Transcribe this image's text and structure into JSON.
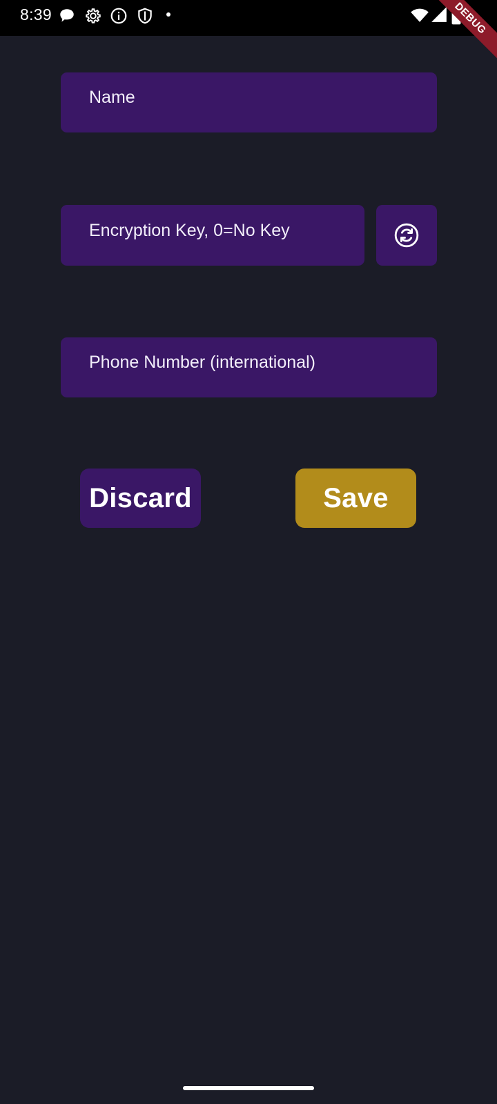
{
  "status_bar": {
    "time": "8:39",
    "left_icons": [
      "chat-bubble-icon",
      "gear-icon",
      "info-icon",
      "shield-icon",
      "dot-icon"
    ],
    "right_icons": [
      "wifi-icon",
      "signal-icon",
      "battery-icon"
    ]
  },
  "debug_banner": "DEBUG",
  "form": {
    "name": {
      "value": "",
      "placeholder": "Name"
    },
    "encryption_key": {
      "value": "",
      "placeholder": "Encryption Key, 0=No Key",
      "regenerate_icon": "refresh-circle-icon"
    },
    "phone": {
      "value": "",
      "placeholder": "Phone Number (international)"
    }
  },
  "actions": {
    "discard_label": "Discard",
    "save_label": "Save"
  },
  "colors": {
    "background": "#1b1c27",
    "field": "#3a1766",
    "discard": "#3a1766",
    "save": "#b28c1b",
    "debug_banner": "#8d1b2a"
  }
}
